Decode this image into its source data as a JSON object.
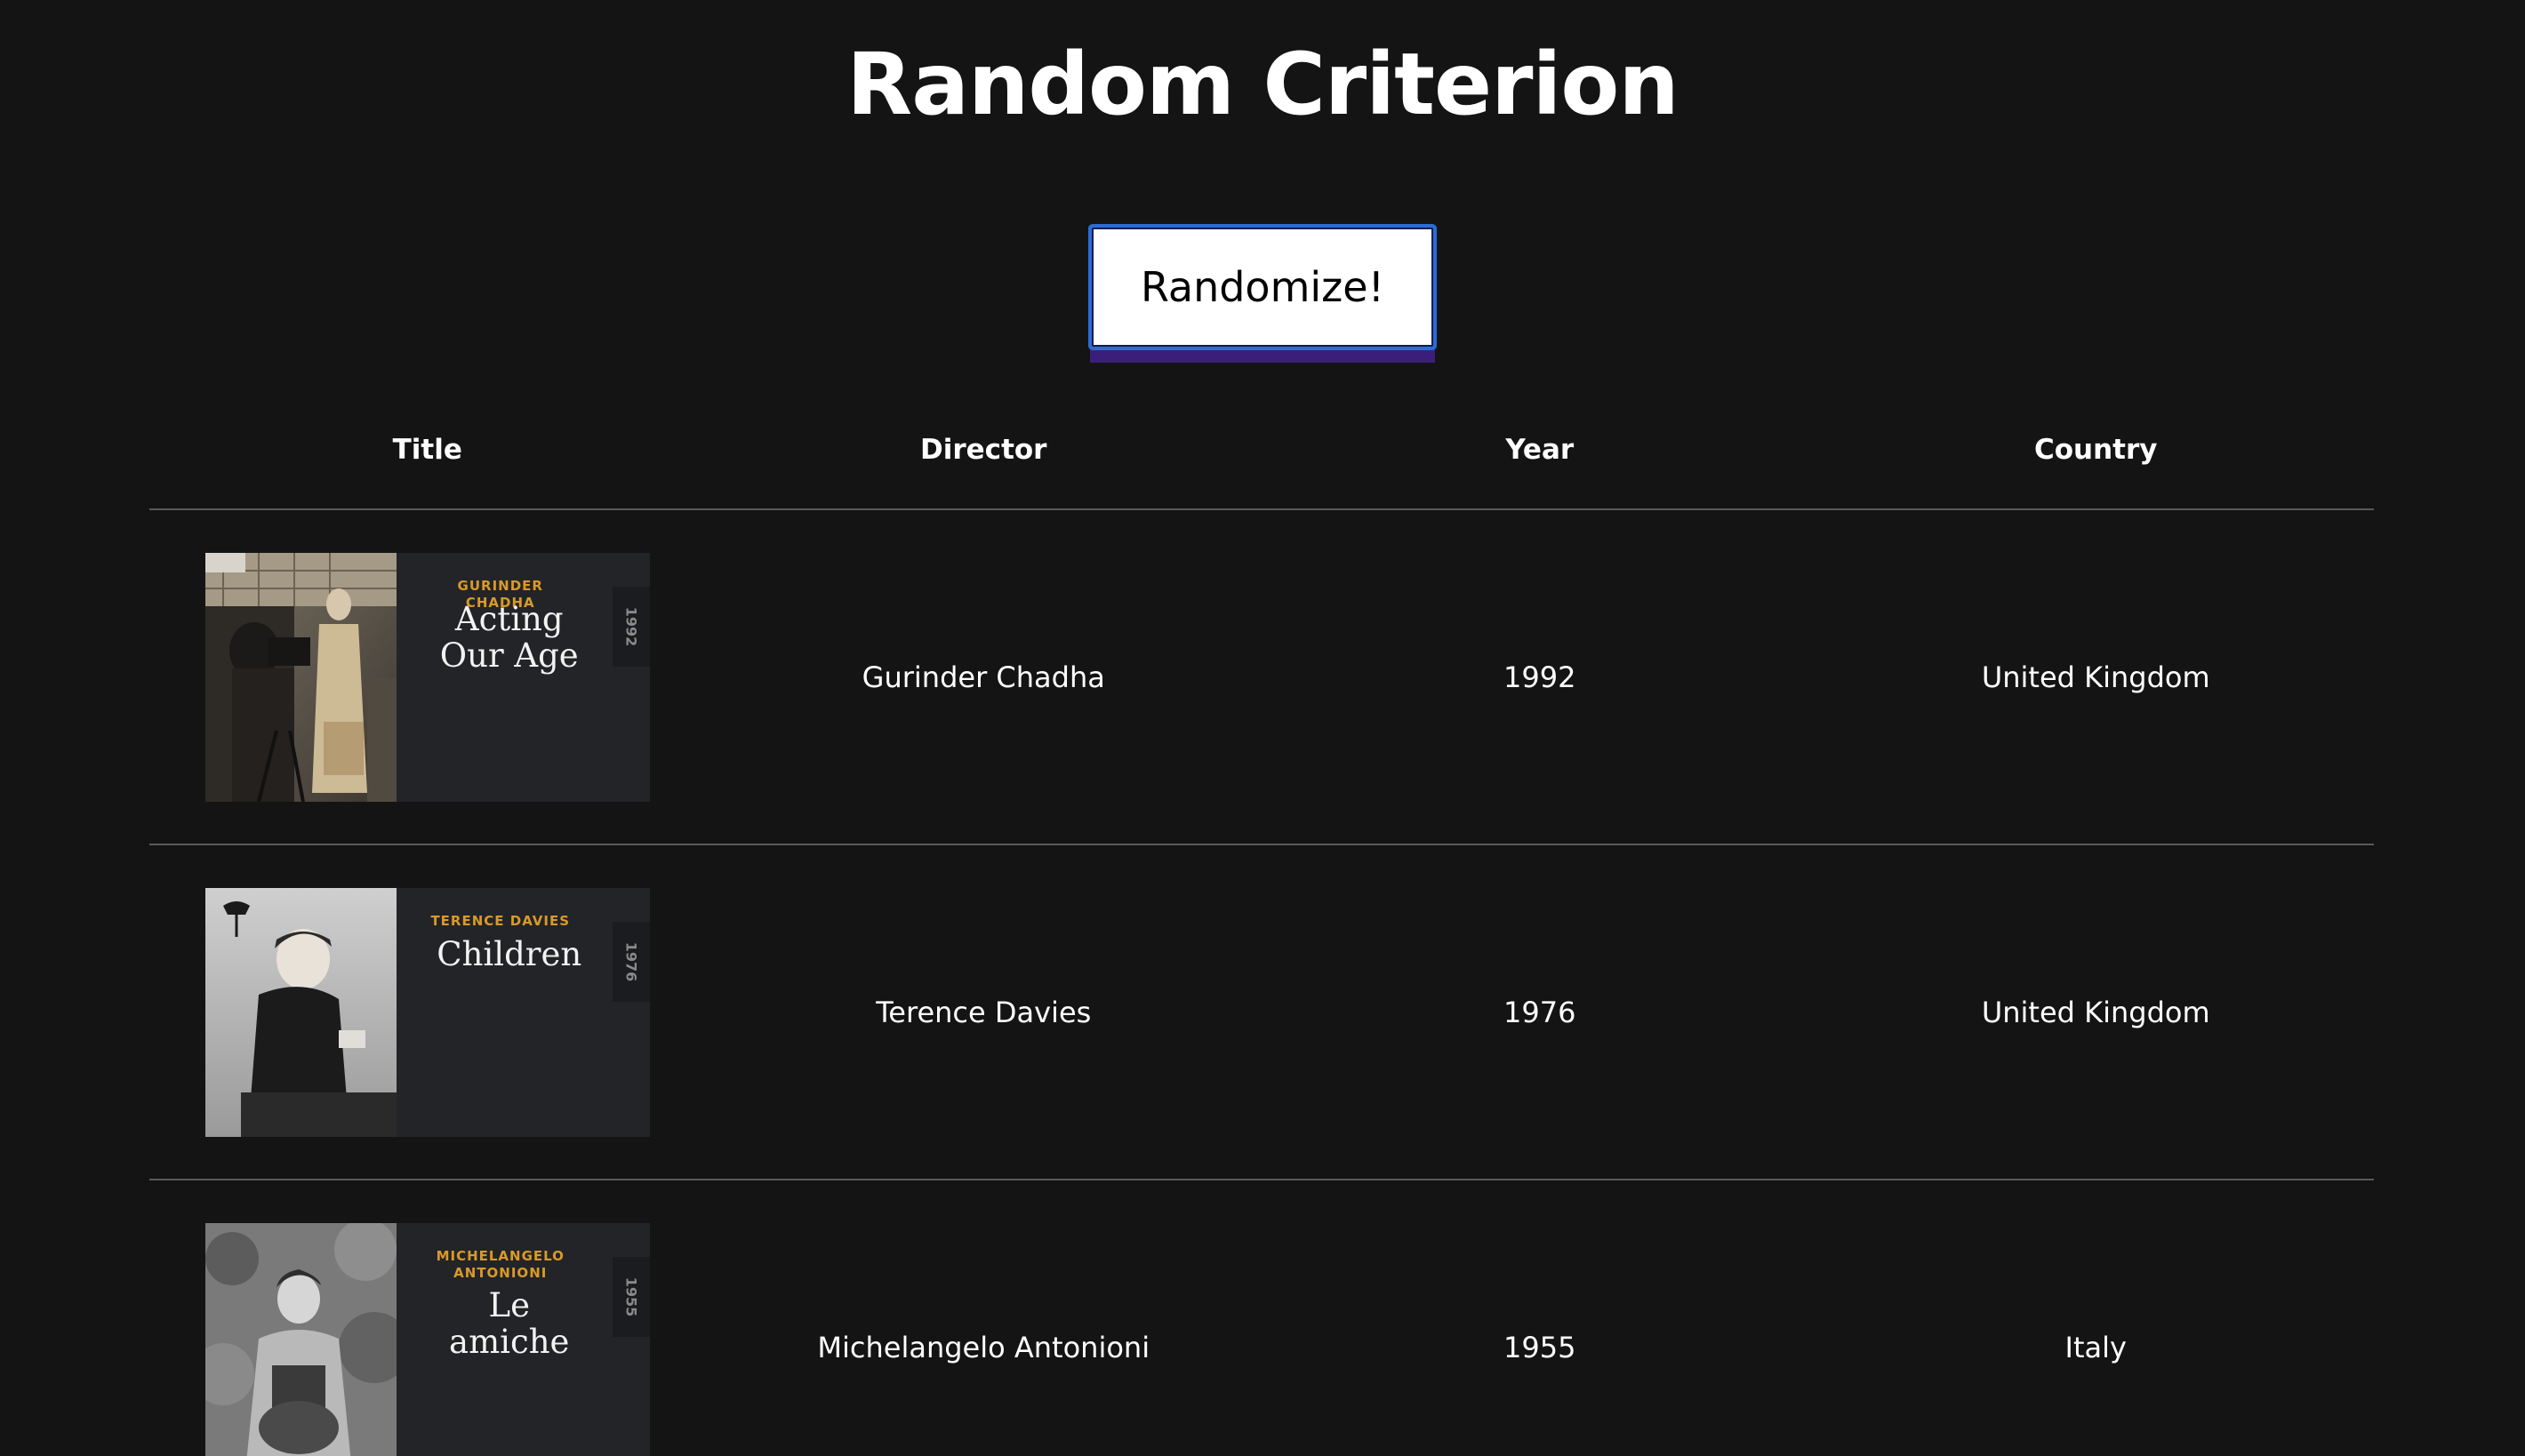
{
  "page": {
    "title": "Random Criterion"
  },
  "controls": {
    "randomize_label": "Randomize!"
  },
  "table": {
    "headers": [
      "Title",
      "Director",
      "Year",
      "Country"
    ],
    "rows": [
      {
        "poster_director": "GURINDER CHADHA",
        "poster_title": "Acting Our Age",
        "poster_year": "1992",
        "director": "Gurinder Chadha",
        "year": "1992",
        "country": "United Kingdom"
      },
      {
        "poster_director": "TERENCE DAVIES",
        "poster_title": "Children",
        "poster_year": "1976",
        "director": "Terence Davies",
        "year": "1976",
        "country": "United Kingdom"
      },
      {
        "poster_director": "MICHELANGELO ANTONIONI",
        "poster_title": "Le amiche",
        "poster_year": "1955",
        "director": "Michelangelo Antonioni",
        "year": "1955",
        "country": "Italy"
      }
    ]
  },
  "colors": {
    "background": "#141414",
    "poster_accent": "#d99a28",
    "button_border": "#2a6cd6",
    "button_shadow": "#3a1f7a"
  }
}
